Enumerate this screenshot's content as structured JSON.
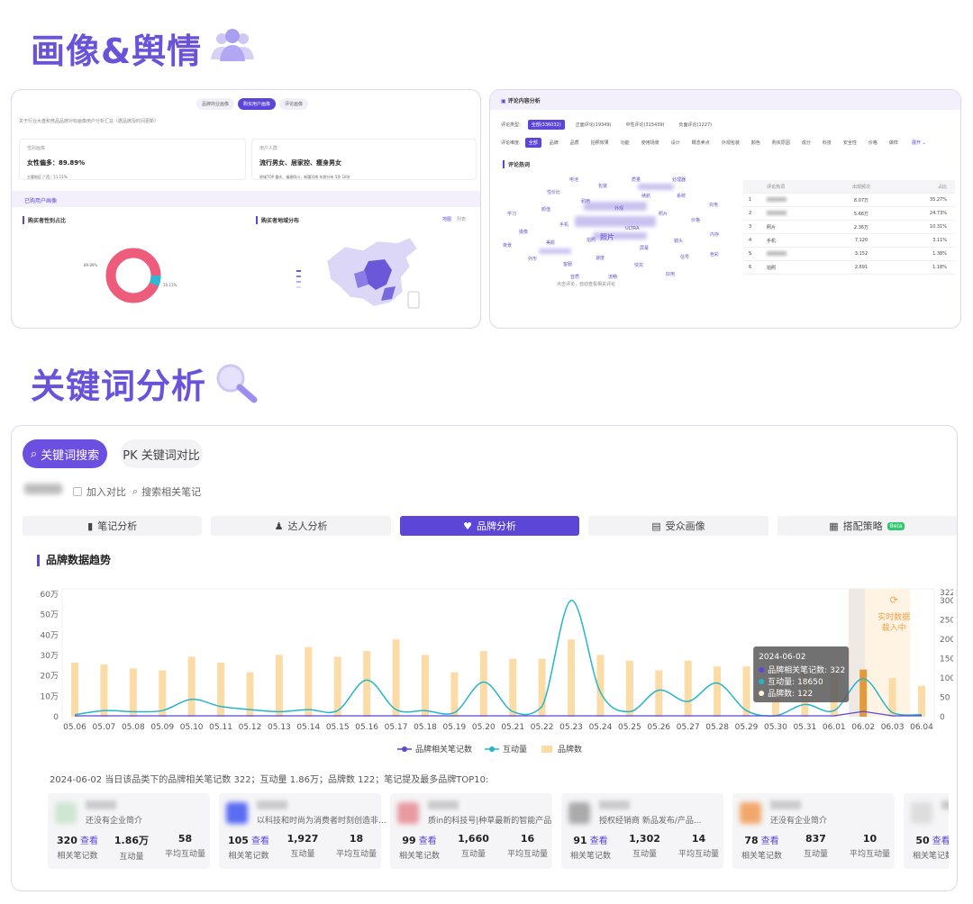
{
  "sections": {
    "portrait_title": "画像&舆情",
    "keyword_title": "关键词分析"
  },
  "portrait_card": {
    "tabs": [
      "品牌商业画像",
      "购买用户画像",
      "评论画像"
    ],
    "note": "关于行业大盘和竞品品牌对标画像用户分析汇总（据品牌及时间更新）",
    "gender_label": "性别画像",
    "gender_value": "女性偏多：89.89%",
    "gender_sub": "主要地区 广西：11.11%",
    "crowd_label": "用户人群",
    "crowd_value": "流行男女、居家控、瘦身男女",
    "crowd_sub": "地域TOP 重庆、福建四川、新疆河南  年龄分布 5岁 18岁",
    "section_header": "已购用户画像",
    "sub_left": "购买者性别占比",
    "sub_right": "购买者地域分布",
    "legend_a": "地图",
    "legend_b": "列表",
    "donut_left_label": "89.89%",
    "donut_right_label": "10.11%"
  },
  "comment_card": {
    "header": "评论内容分析",
    "type_label": "评论类型:",
    "types": [
      "全部(336032)",
      "正面评论(19349)",
      "中性评论(315439)",
      "负面评论(1227)"
    ],
    "dim_label": "评论维度:",
    "dims": [
      "全部",
      "品牌",
      "品质",
      "拍照效果",
      "功能",
      "使用场景",
      "设计",
      "概念卖点",
      "外观包装",
      "颜色",
      "购买原因",
      "成分",
      "科技",
      "安全性",
      "价格",
      "做样"
    ],
    "more": "展开 ⌄",
    "hot_label": "评论热词",
    "cloud_words": [
      "ULTRA",
      "拍照",
      "外观",
      "屏幕",
      "手机",
      "照片",
      "速度",
      "耐用",
      "镜头",
      "美颜",
      "续航",
      "快充",
      "颜值",
      "价格",
      "客服",
      "包装",
      "信号",
      "摄像",
      "系统",
      "流畅",
      "性价比",
      "内存",
      "外形",
      "质量",
      "好用",
      "学习",
      "充电",
      "音质",
      "电池",
      "色彩",
      "夜景",
      "处理器"
    ],
    "cloud_main": "照片",
    "cloud_footer": "点击评论，自动查看相关评论",
    "table_header": [
      "",
      "评论热词",
      "出现频次",
      "占比"
    ],
    "table_rows": [
      [
        "1",
        "",
        "8.07万",
        "35.27%"
      ],
      [
        "2",
        "",
        "5.66万",
        "24.73%"
      ],
      [
        "3",
        "照片",
        "2.36万",
        "10.31%"
      ],
      [
        "4",
        "手机",
        "7,120",
        "3.11%"
      ],
      [
        "5",
        "",
        "3,152",
        "1.38%"
      ],
      [
        "6",
        "拍照",
        "2,691",
        "1.18%"
      ]
    ]
  },
  "keyword_card": {
    "search_pill": "关键词搜索",
    "pk_pill": "PK 关键词对比",
    "add_compare": "加入对比",
    "search_notes": "搜索相关笔记",
    "tabs": [
      {
        "label": "笔记分析",
        "icon": "notebook-icon"
      },
      {
        "label": "达人分析",
        "icon": "user-icon"
      },
      {
        "label": "品牌分析",
        "icon": "diamond-icon"
      },
      {
        "label": "受众画像",
        "icon": "profile-icon"
      },
      {
        "label": "搭配策略",
        "icon": "strategy-icon",
        "badge": "Beta"
      }
    ],
    "active_tab": 2,
    "trend_title": "品牌数据趋势",
    "loading_text": "实时数据载入中",
    "summary": "2024-06-02 当日该品类下的品牌相关笔记数 322；互动量 1.86万；品牌数 122；笔记提及最多品牌TOP10:",
    "brand_cards": [
      {
        "desc": "还没有企业简介",
        "notes": "320",
        "look": "查看",
        "interact": "1.86万",
        "avg": "58",
        "logo_color": "#cfe6d2"
      },
      {
        "desc": "以科技和时尚为消费者时刻创造非...",
        "notes": "105",
        "look": "查看",
        "interact": "1,927",
        "avg": "18",
        "logo_color": "#5a6cf2"
      },
      {
        "desc": "质in的科技号|种草最新的智能产品",
        "notes": "99",
        "look": "查看",
        "interact": "1,660",
        "avg": "16",
        "logo_color": "#e89aa1"
      },
      {
        "desc": "授权经销商 新品发布/产品...",
        "notes": "91",
        "look": "查看",
        "interact": "1,302",
        "avg": "14",
        "logo_color": "#aaaaaa"
      },
      {
        "desc": "还没有企业简介",
        "notes": "78",
        "look": "查看",
        "interact": "837",
        "avg": "10",
        "logo_color": "#f2a86c"
      },
      {
        "desc": "",
        "notes": "50",
        "look": "查看",
        "interact": "",
        "avg": "",
        "logo_color": "#dddddd"
      }
    ],
    "stat_labels": {
      "notes": "相关笔记数",
      "interact": "互动量",
      "avg": "平均互动量"
    }
  },
  "chart_data": {
    "type": "bar",
    "categories": [
      "05.06",
      "05.07",
      "05.08",
      "05.09",
      "05.10",
      "05.11",
      "05.12",
      "05.13",
      "05.14",
      "05.15",
      "05.16",
      "05.17",
      "05.18",
      "05.19",
      "05.20",
      "05.21",
      "05.22",
      "05.23",
      "05.24",
      "05.25",
      "05.26",
      "05.27",
      "05.28",
      "05.29",
      "05.30",
      "05.31",
      "06.01",
      "06.02",
      "06.03",
      "06.04"
    ],
    "series": [
      {
        "name": "品牌相关笔记数",
        "axis": "left",
        "values": [
          2,
          2,
          2,
          2,
          2,
          2,
          2,
          2,
          2,
          2,
          2,
          2,
          2,
          2,
          2,
          2,
          2,
          2,
          2,
          2,
          2,
          2,
          2,
          2,
          2,
          2,
          2,
          322,
          2,
          2
        ],
        "color": "#5b46d8",
        "kind": "line"
      },
      {
        "name": "互动量",
        "axis": "left",
        "values": [
          1000,
          3000,
          2500,
          3000,
          8500,
          5000,
          3500,
          2500,
          3500,
          3000,
          18000,
          3500,
          3000,
          2000,
          17000,
          2500,
          5000,
          57000,
          12000,
          2500,
          13000,
          7500,
          16500,
          3000,
          500,
          6000,
          3000,
          18650,
          2000,
          1000
        ],
        "color": "#23b5cc",
        "kind": "line"
      },
      {
        "name": "品牌数",
        "axis": "right",
        "values": [
          140,
          135,
          125,
          120,
          155,
          140,
          115,
          160,
          180,
          155,
          170,
          200,
          160,
          115,
          170,
          150,
          150,
          200,
          160,
          145,
          120,
          145,
          130,
          130,
          145,
          130,
          120,
          122,
          100,
          80
        ],
        "color": "#fcdca6",
        "kind": "bar"
      }
    ],
    "y_left": {
      "ticks": [
        "0",
        "10万",
        "20万",
        "30万",
        "40万",
        "50万",
        "60万"
      ],
      "max": 60000
    },
    "y_right": {
      "ticks": [
        "0",
        "50",
        "100",
        "150",
        "200",
        "250",
        "300",
        "322"
      ],
      "max": 322
    },
    "tooltip": {
      "date": "2024-06-02",
      "lines": [
        "品牌相关笔记数: 322",
        "互动量: 18650",
        "品牌数: 122"
      ]
    },
    "highlight_index": 27
  }
}
